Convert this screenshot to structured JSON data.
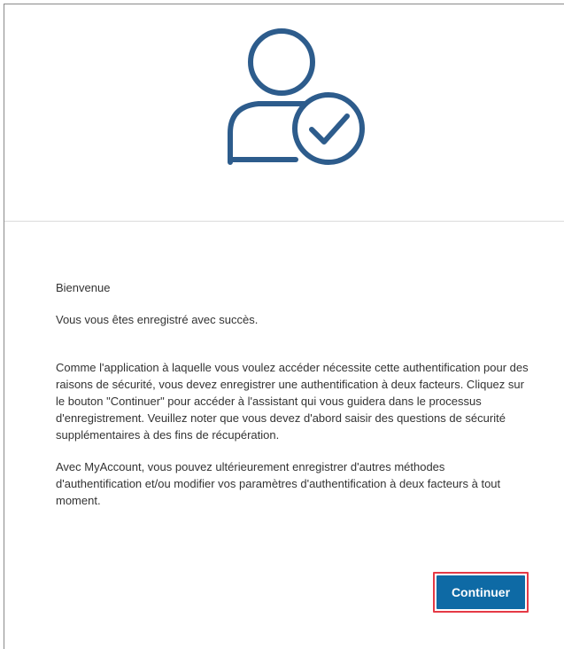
{
  "icon": {
    "name": "user-check-icon",
    "color": "#2d5c8c"
  },
  "content": {
    "title": "Bienvenue",
    "success": "Vous vous êtes enregistré avec succès.",
    "paragraph1": "Comme l'application à laquelle vous voulez accéder nécessite cette authentification pour des raisons de sécurité, vous devez enregistrer une authentification à deux facteurs. Cliquez sur le bouton \"Continuer\" pour accéder à l'assistant qui vous guidera dans le processus d'enregistrement. Veuillez noter que vous devez d'abord saisir des questions de sécurité supplémentaires à des fins de récupération.",
    "paragraph2": "Avec MyAccount, vous pouvez ultérieurement enregistrer d'autres méthodes d'authentification et/ou modifier vos paramètres d'authentification à deux facteurs à tout moment."
  },
  "actions": {
    "continue_label": "Continuer",
    "button_color": "#0e6aa5",
    "highlight_color": "#e53a46"
  }
}
